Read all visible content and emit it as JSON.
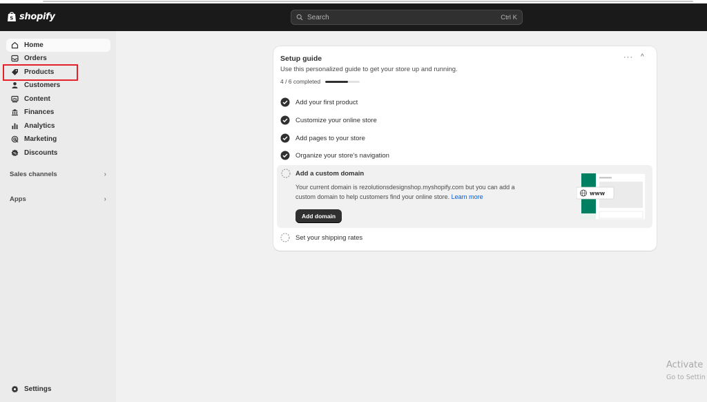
{
  "topbar": {
    "brand": "shopify",
    "search_placeholder": "Search",
    "search_shortcut": "Ctrl K"
  },
  "sidebar": {
    "items": [
      {
        "label": "Home",
        "icon": "home-icon",
        "active": true
      },
      {
        "label": "Orders",
        "icon": "inbox-icon"
      },
      {
        "label": "Products",
        "icon": "tag-icon"
      },
      {
        "label": "Customers",
        "icon": "person-icon"
      },
      {
        "label": "Content",
        "icon": "content-icon"
      },
      {
        "label": "Finances",
        "icon": "bank-icon"
      },
      {
        "label": "Analytics",
        "icon": "bar-chart-icon"
      },
      {
        "label": "Marketing",
        "icon": "target-icon"
      },
      {
        "label": "Discounts",
        "icon": "discount-icon"
      }
    ],
    "sales_channels": "Sales channels",
    "apps": "Apps",
    "settings": "Settings",
    "highlighted_item": "Products",
    "highlight_color": "#e4202a"
  },
  "setup_guide": {
    "title": "Setup guide",
    "subtitle": "Use this personalized guide to get your store up and running.",
    "progress_text": "4 / 6 completed",
    "progress_fraction": 0.667,
    "tasks": [
      {
        "label": "Add your first product",
        "done": true
      },
      {
        "label": "Customize your online store",
        "done": true
      },
      {
        "label": "Add pages to your store",
        "done": true
      },
      {
        "label": "Organize your store's navigation",
        "done": true
      }
    ],
    "expanded_task": {
      "title": "Add a custom domain",
      "description": "Your current domain is rezolutionsdesignshop.myshopify.com but you can add a custom domain to help customers find your online store.",
      "link": "Learn more",
      "button": "Add domain",
      "illustration_label": "www"
    },
    "last_task": {
      "label": "Set your shipping rates",
      "done": false
    }
  },
  "watermark": {
    "line1": "Activate",
    "line2": "Go to Settin"
  },
  "colors": {
    "accent_green": "#008060",
    "topbar": "#1a1a1a",
    "link": "#005bd3"
  }
}
